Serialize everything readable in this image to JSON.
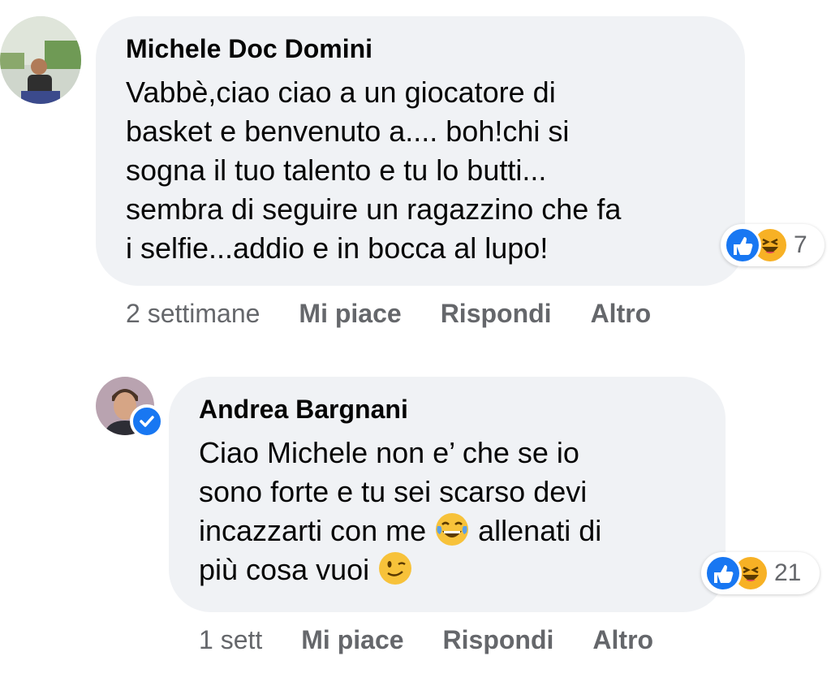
{
  "comments": [
    {
      "author": "Michele Doc Domini",
      "lines": [
        "Vabbè,ciao ciao a un giocatore di",
        "basket e benvenuto a.... boh!chi si",
        "sogna il tuo talento e tu lo butti...",
        "sembra di seguire un ragazzino che fa",
        "i selfie...addio e in bocca al lupo!"
      ],
      "reaction_count": "7",
      "time": "2 settimane",
      "like_label": "Mi piace",
      "reply_label": "Rispondi",
      "more_label": "Altro"
    },
    {
      "author": "Andrea Bargnani",
      "lines": [
        "Ciao Michele non e’ che se io",
        "sono forte e tu sei scarso devi",
        "incazzarti con me",
        "allenati di",
        "più cosa vuoi"
      ],
      "reaction_count": "21",
      "time": "1 sett",
      "like_label": "Mi piace",
      "reply_label": "Rispondi",
      "more_label": "Altro",
      "verified": true
    }
  ],
  "icons": {
    "reactions": [
      "like-icon",
      "haha-icon"
    ],
    "inline_emoji": [
      "tears-of-joy-emoji",
      "wink-emoji"
    ]
  },
  "colors": {
    "bubble": "#f0f2f5",
    "like": "#1877f2",
    "haha": "#f7b125",
    "meta": "#65676b"
  }
}
